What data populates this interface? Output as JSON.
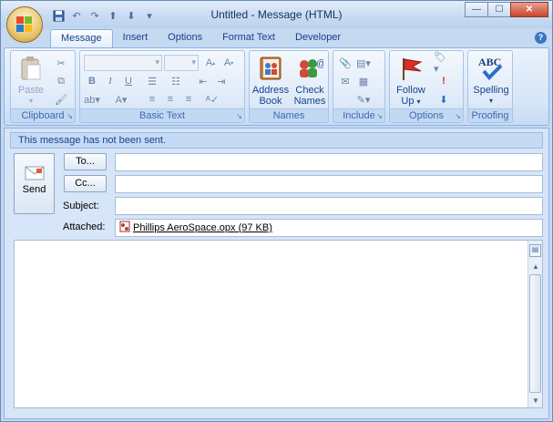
{
  "window": {
    "title": "Untitled - Message (HTML)",
    "controls": {
      "minimize": "—",
      "maximize": "☐",
      "close": "✕"
    }
  },
  "quick_access": {
    "icons": [
      "save-icon",
      "undo-icon",
      "redo-icon",
      "up-icon",
      "down-icon",
      "customize-icon"
    ]
  },
  "tabs": [
    {
      "label": "Message",
      "active": true
    },
    {
      "label": "Insert"
    },
    {
      "label": "Options"
    },
    {
      "label": "Format Text"
    },
    {
      "label": "Developer"
    }
  ],
  "ribbon": {
    "clipboard": {
      "label": "Clipboard",
      "paste": "Paste"
    },
    "basic_text": {
      "label": "Basic Text"
    },
    "names": {
      "label": "Names",
      "address_book_1": "Address",
      "address_book_2": "Book",
      "check_names_1": "Check",
      "check_names_2": "Names"
    },
    "include": {
      "label": "Include"
    },
    "options": {
      "label": "Options",
      "follow_up_1": "Follow",
      "follow_up_2": "Up"
    },
    "proofing": {
      "label": "Proofing",
      "spelling": "Spelling",
      "abc": "ABC"
    }
  },
  "message": {
    "info": "This message has not been sent.",
    "send_label": "Send",
    "to_label": "To...",
    "cc_label": "Cc...",
    "subject_label": "Subject:",
    "attached_label": "Attached:",
    "to_value": "",
    "cc_value": "",
    "subject_value": "",
    "attachment": "Phillips AeroSpace.opx (97 KB)",
    "body": ""
  },
  "colors": {
    "accent": "#15428b",
    "ribbon_bg": "#d7e6f8",
    "frame": "#c5d9f1"
  }
}
